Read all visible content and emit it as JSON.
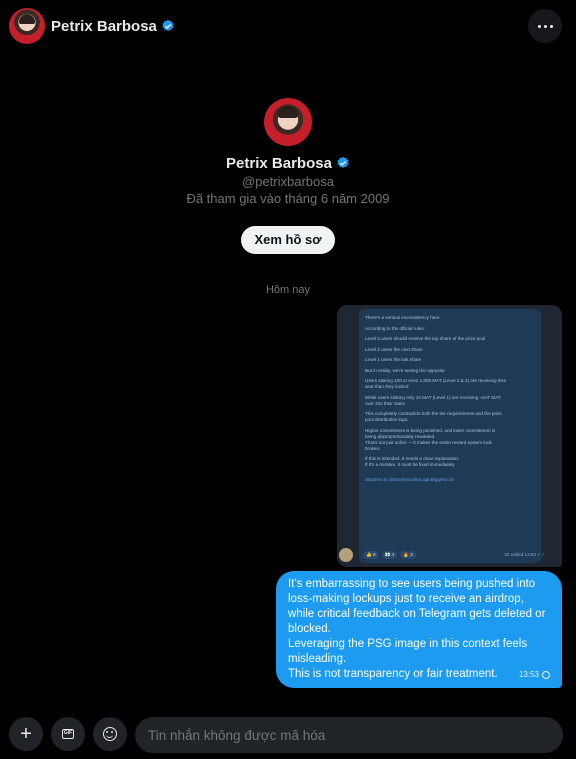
{
  "header": {
    "name": "Petrix Barbosa",
    "more_icon": "more-horizontal-icon"
  },
  "profile": {
    "name": "Petrix Barbosa",
    "handle": "@petrixbarbosa",
    "joined": "Đã tham gia vào tháng 6 năm 2009",
    "view_button": "Xem hồ sơ"
  },
  "conversation": {
    "date_separator": "Hôm nay",
    "image_message": {
      "lines": [
        "There's a serious inconsistency here.",
        "",
        "According to the official rules:",
        "",
        "Level 3 users should receive the top share of the prize pool",
        "",
        "Level 2 users the next share",
        "",
        "Level 1 users the last share",
        "",
        "But in reality, we're seeing the opposite:",
        "",
        "Users staking 100 or even 1,000 MAT (Level 2 & 3) are receiving less",
        "seat than they locked",
        "",
        "While users staking only 10 MAT (Level 1) are receiving ~2AT MAT",
        "over 20x their stake",
        "",
        "This completely contradicts both the tier requirements and the prize",
        "pool distribution logic.",
        "",
        "Higher commitment is being punished, and lower commitment is",
        "being disproportionately rewarded.",
        "That's not just unfair — it makes the entire reward system look",
        "broken.",
        "",
        "If this is intended, it needs a clear explanation.",
        "If it's a mistake, it must be fixed immediately.",
        "",
        "",
        "attached to @DonkeyUnityLogicBiggest LW"
      ],
      "footer": {
        "reactions": [
          "👍 8",
          "👀 4",
          "🔥 3"
        ],
        "meta": "33 edited 13:53 ✓✓"
      }
    },
    "text_message": {
      "paragraphs": [
        "It’s embarrassing to see users being pushed into loss-making lockups just to receive an airdrop, while critical feedback on Telegram gets deleted or blocked.",
        "Leveraging the PSG image in this context feels misleading.",
        "This is not transparency or fair treatment."
      ],
      "time": "13:53"
    }
  },
  "composer": {
    "placeholder": "Tin nhắn không được mã hóa",
    "plus_icon": "plus-icon",
    "gif_icon": "gif-icon",
    "emoji_icon": "emoji-icon"
  },
  "colors": {
    "background": "#000000",
    "bubble": "#1d9bf0",
    "verified": "#1d9bf0",
    "muted_text": "#71767b"
  }
}
